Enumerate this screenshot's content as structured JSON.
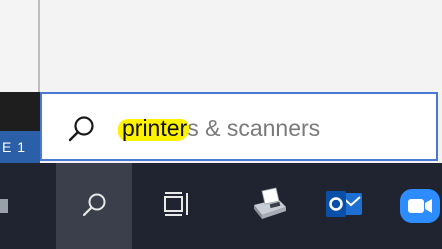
{
  "background": {
    "left_label": "E 1"
  },
  "search": {
    "typed": "printer",
    "suggestion": "s & scanners",
    "highlight_color": "#fff200",
    "border_color": "#4a78d6"
  },
  "taskbar": {
    "background_color": "#1f2430",
    "items": [
      {
        "icon": "search-icon",
        "active": true
      },
      {
        "icon": "task-view-icon",
        "active": false
      },
      {
        "icon": "printer-fax-icon",
        "active": false
      },
      {
        "icon": "outlook-icon",
        "active": false
      },
      {
        "icon": "zoom-icon",
        "active": false
      }
    ]
  }
}
